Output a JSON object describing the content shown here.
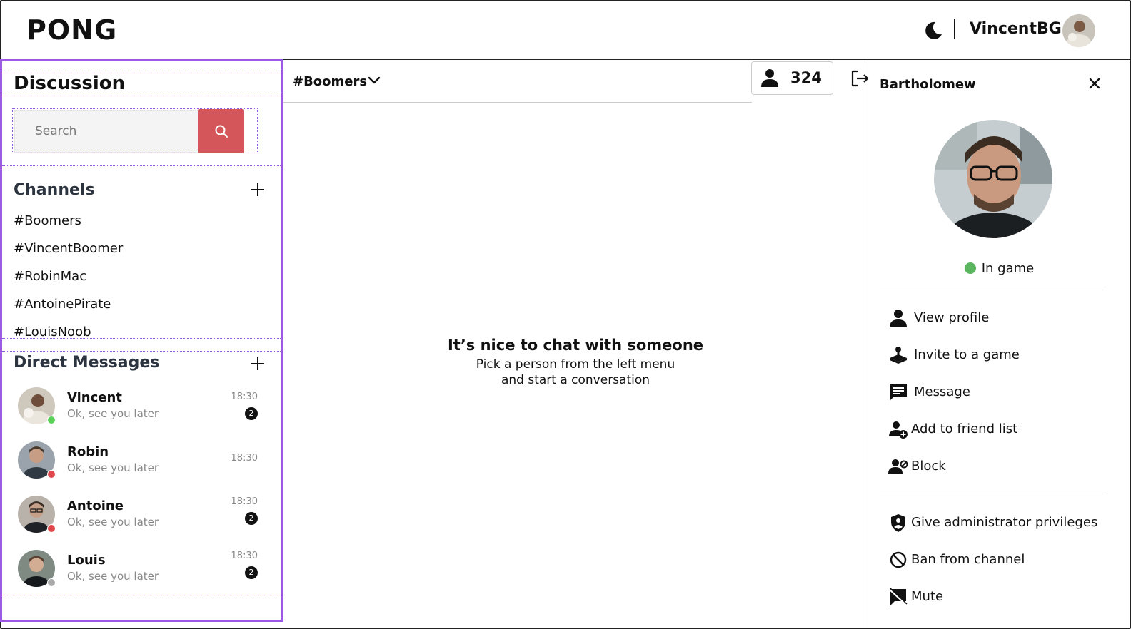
{
  "header": {
    "logo": "PONG",
    "username": "VincentBG",
    "theme_icon": "moon-icon"
  },
  "sidebar": {
    "title": "Discussion",
    "search": {
      "placeholder": "Search",
      "button_icon": "search-icon"
    },
    "channels": {
      "title": "Channels",
      "items": [
        "#Boomers",
        "#VincentBoomer",
        "#RobinMac",
        "#AntoinePirate",
        "#LouisNoob"
      ]
    },
    "direct_messages": {
      "title": "Direct Messages",
      "items": [
        {
          "name": "Vincent",
          "message": "Ok, see you later",
          "time": "18:30",
          "unread": "2",
          "status": "online",
          "status_color": "#5bd35b"
        },
        {
          "name": "Robin",
          "message": "Ok, see you later",
          "time": "18:30",
          "unread": "",
          "status": "busy",
          "status_color": "#e0474c"
        },
        {
          "name": "Antoine",
          "message": "Ok, see you later",
          "time": "18:30",
          "unread": "2",
          "status": "busy",
          "status_color": "#e0474c"
        },
        {
          "name": "Louis",
          "message": "Ok, see you later",
          "time": "18:30",
          "unread": "2",
          "status": "offline",
          "status_color": "#a8a8a8"
        }
      ]
    }
  },
  "channel": {
    "name": "#Boomers",
    "member_count": "324",
    "empty_title": "It’s nice to chat with someone",
    "empty_line1": "Pick a person from the left menu",
    "empty_line2": "and start a conversation"
  },
  "profile_panel": {
    "name": "Bartholomew",
    "status": "In game",
    "status_color": "#5bb55e",
    "actions": [
      {
        "label": "View profile",
        "icon": "user-icon"
      },
      {
        "label": "Invite to a game",
        "icon": "joystick-icon"
      },
      {
        "label": "Message",
        "icon": "chat-icon"
      },
      {
        "label": "Add to friend list",
        "icon": "add-friend-icon"
      },
      {
        "label": "Block",
        "icon": "block-user-icon"
      }
    ],
    "admin_actions": [
      {
        "label": "Give administrator privileges",
        "icon": "shield-icon"
      },
      {
        "label": "Ban from channel",
        "icon": "ban-icon"
      },
      {
        "label": "Mute",
        "icon": "mute-icon"
      }
    ]
  },
  "colors": {
    "accent": "#9b59e6",
    "search_button": "#d4565a"
  }
}
